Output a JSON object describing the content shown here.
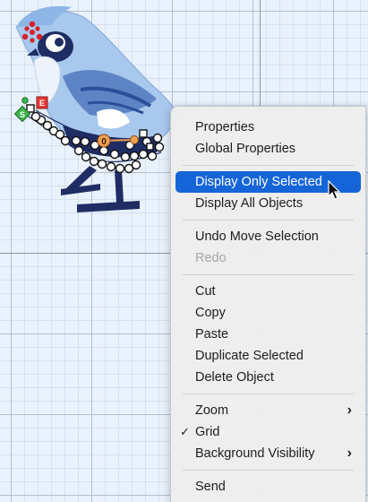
{
  "menu": {
    "groups": [
      [
        {
          "label": "Properties"
        },
        {
          "label": "Global Properties"
        }
      ],
      [
        {
          "label": "Display Only Selected"
        },
        {
          "label": "Display All Objects"
        }
      ],
      [
        {
          "label": "Undo Move Selection"
        },
        {
          "label": "Redo"
        }
      ],
      [
        {
          "label": "Cut"
        },
        {
          "label": "Copy"
        },
        {
          "label": "Paste"
        },
        {
          "label": "Duplicate Selected"
        },
        {
          "label": "Delete Object"
        }
      ],
      [
        {
          "label": "Zoom",
          "chevron": "›"
        },
        {
          "label": "Grid",
          "check": "✓"
        },
        {
          "label": "Background Visibility",
          "chevron": "›"
        }
      ],
      [
        {
          "label": "Send"
        }
      ]
    ]
  },
  "handles": {
    "start_label": "S",
    "end_label": "E",
    "selected_node_label": "0"
  },
  "colors": {
    "highlight": "#1565d8",
    "bird_light_blue": "#a9c8ee",
    "bird_dark_blue": "#1f2d64",
    "start_handle": "#3cb54a",
    "end_handle": "#e53935",
    "selected_node": "#f0a050"
  }
}
